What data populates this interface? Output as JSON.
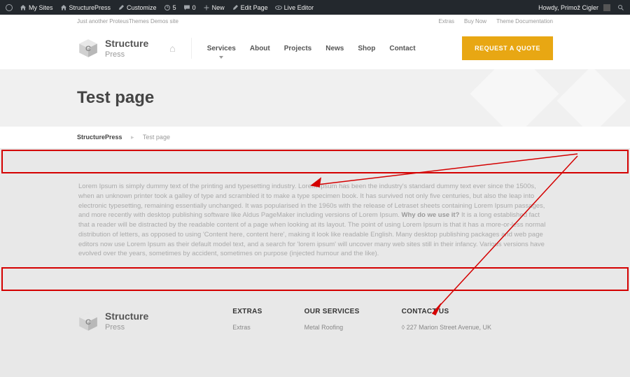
{
  "adminbar": {
    "mysites": "My Sites",
    "sitename": "StructurePress",
    "customize": "Customize",
    "updates": "5",
    "comments": "0",
    "new": "New",
    "edit": "Edit Page",
    "live": "Live Editor",
    "howdy": "Howdy, Primož Cigler"
  },
  "topstrip": {
    "tagline": "Just another ProteusThemes Demos site",
    "links": [
      "Extras",
      "Buy Now",
      "Theme Documentation"
    ]
  },
  "logo": {
    "line1": "Structure",
    "line2": "Press"
  },
  "nav": [
    "Services",
    "About",
    "Projects",
    "News",
    "Shop",
    "Contact"
  ],
  "quote": "REQUEST A QUOTE",
  "hero": "Test page",
  "crumbs": {
    "home": "StructurePress",
    "current": "Test page"
  },
  "content": {
    "p1": "Lorem Ipsum is simply dummy text of the printing and typesetting industry. Lorem Ipsum has been the industry's standard dummy text ever since the 1500s, when an unknown printer took a galley of type and scrambled it to make a type specimen book. It has survived not only five centuries, but also the leap into electronic typesetting, remaining essentially unchanged. It was popularised in the 1960s with the release of Letraset sheets containing Lorem Ipsum passages, and more recently with desktop publishing software like Aldus PageMaker including versions of Lorem Ipsum.",
    "b": "Why do we use it?",
    "p2": " It is a long established fact that a reader will be distracted by the readable content of a page when looking at its layout. The point of using Lorem Ipsum is that it has a more-or-less normal distribution of letters, as opposed to using 'Content here, content here', making it look like readable English. Many desktop publishing packages and web page editors now use Lorem Ipsum as their default model text, and a search for 'lorem ipsum' will uncover many web sites still in their infancy. Various versions have evolved over the years, sometimes by accident, sometimes on purpose (injected humour and the like)."
  },
  "footer": {
    "extras": {
      "title": "EXTRAS",
      "items": [
        "Extras"
      ]
    },
    "services": {
      "title": "OUR SERVICES",
      "items": [
        "Metal Roofing"
      ]
    },
    "contact": {
      "title": "CONTACT US",
      "addr": "227 Marion Street Avenue, UK"
    }
  }
}
